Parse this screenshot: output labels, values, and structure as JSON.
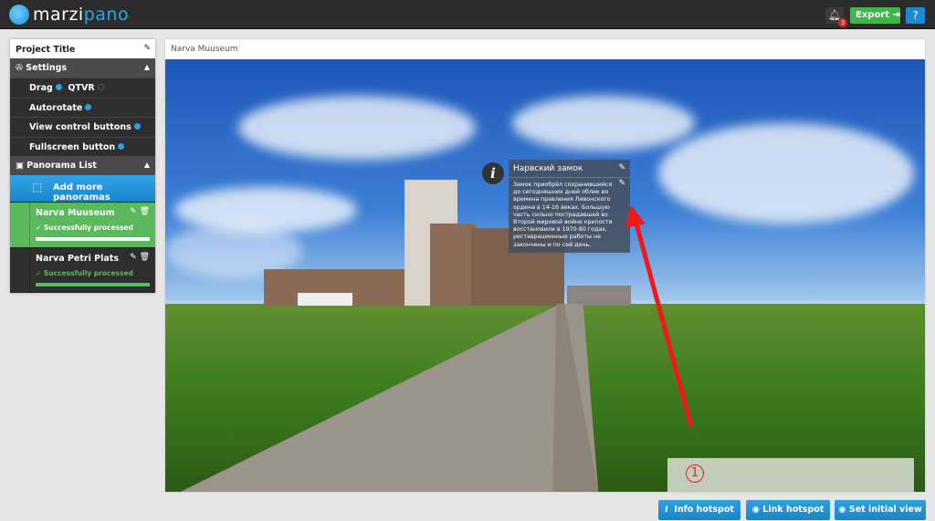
{
  "app": {
    "logo_left": "marzi",
    "logo_right": "pano",
    "notifications_count": "3",
    "export_label": "Export",
    "help_label": "?"
  },
  "sidebar": {
    "project_title": "Project Title",
    "settings": {
      "label": "Settings",
      "drag": "Drag",
      "qtvr": "QTVR",
      "autorotate": "Autorotate",
      "view_control": "View control buttons",
      "fullscreen": "Fullscreen button"
    },
    "panorama_list": {
      "label": "Panorama List",
      "add_label": "Add more panoramas",
      "items": [
        {
          "name": "Narva Muuseum",
          "status": "✓ Successfully processed",
          "active": true,
          "progress": 100
        },
        {
          "name": "Narva Petri Plats",
          "status": "✓ Successfully processed",
          "active": false,
          "progress": 100
        }
      ]
    }
  },
  "main": {
    "title": "Narva Muuseum",
    "hotspot": {
      "title": "Нарвский замок",
      "text": "Замок приобрёл сохранившийся до сегодняшних дней облик во времена правления Ливонского ордена в 14-16 веках. Большую часть сильно пострадавшей во Второй мировой войне крепости восстановили в 1970-80 годах, реставрационные работы не закончены и по сей день."
    },
    "annotation": "1"
  },
  "toolbar": {
    "info_hotspot": "Info hotspot",
    "link_hotspot": "Link hotspot",
    "set_initial_view": "Set initial view"
  },
  "colors": {
    "accent": "#27a3e4",
    "success": "#5cb85c",
    "export": "#3fb54b",
    "topbar": "#2b2b2b"
  }
}
